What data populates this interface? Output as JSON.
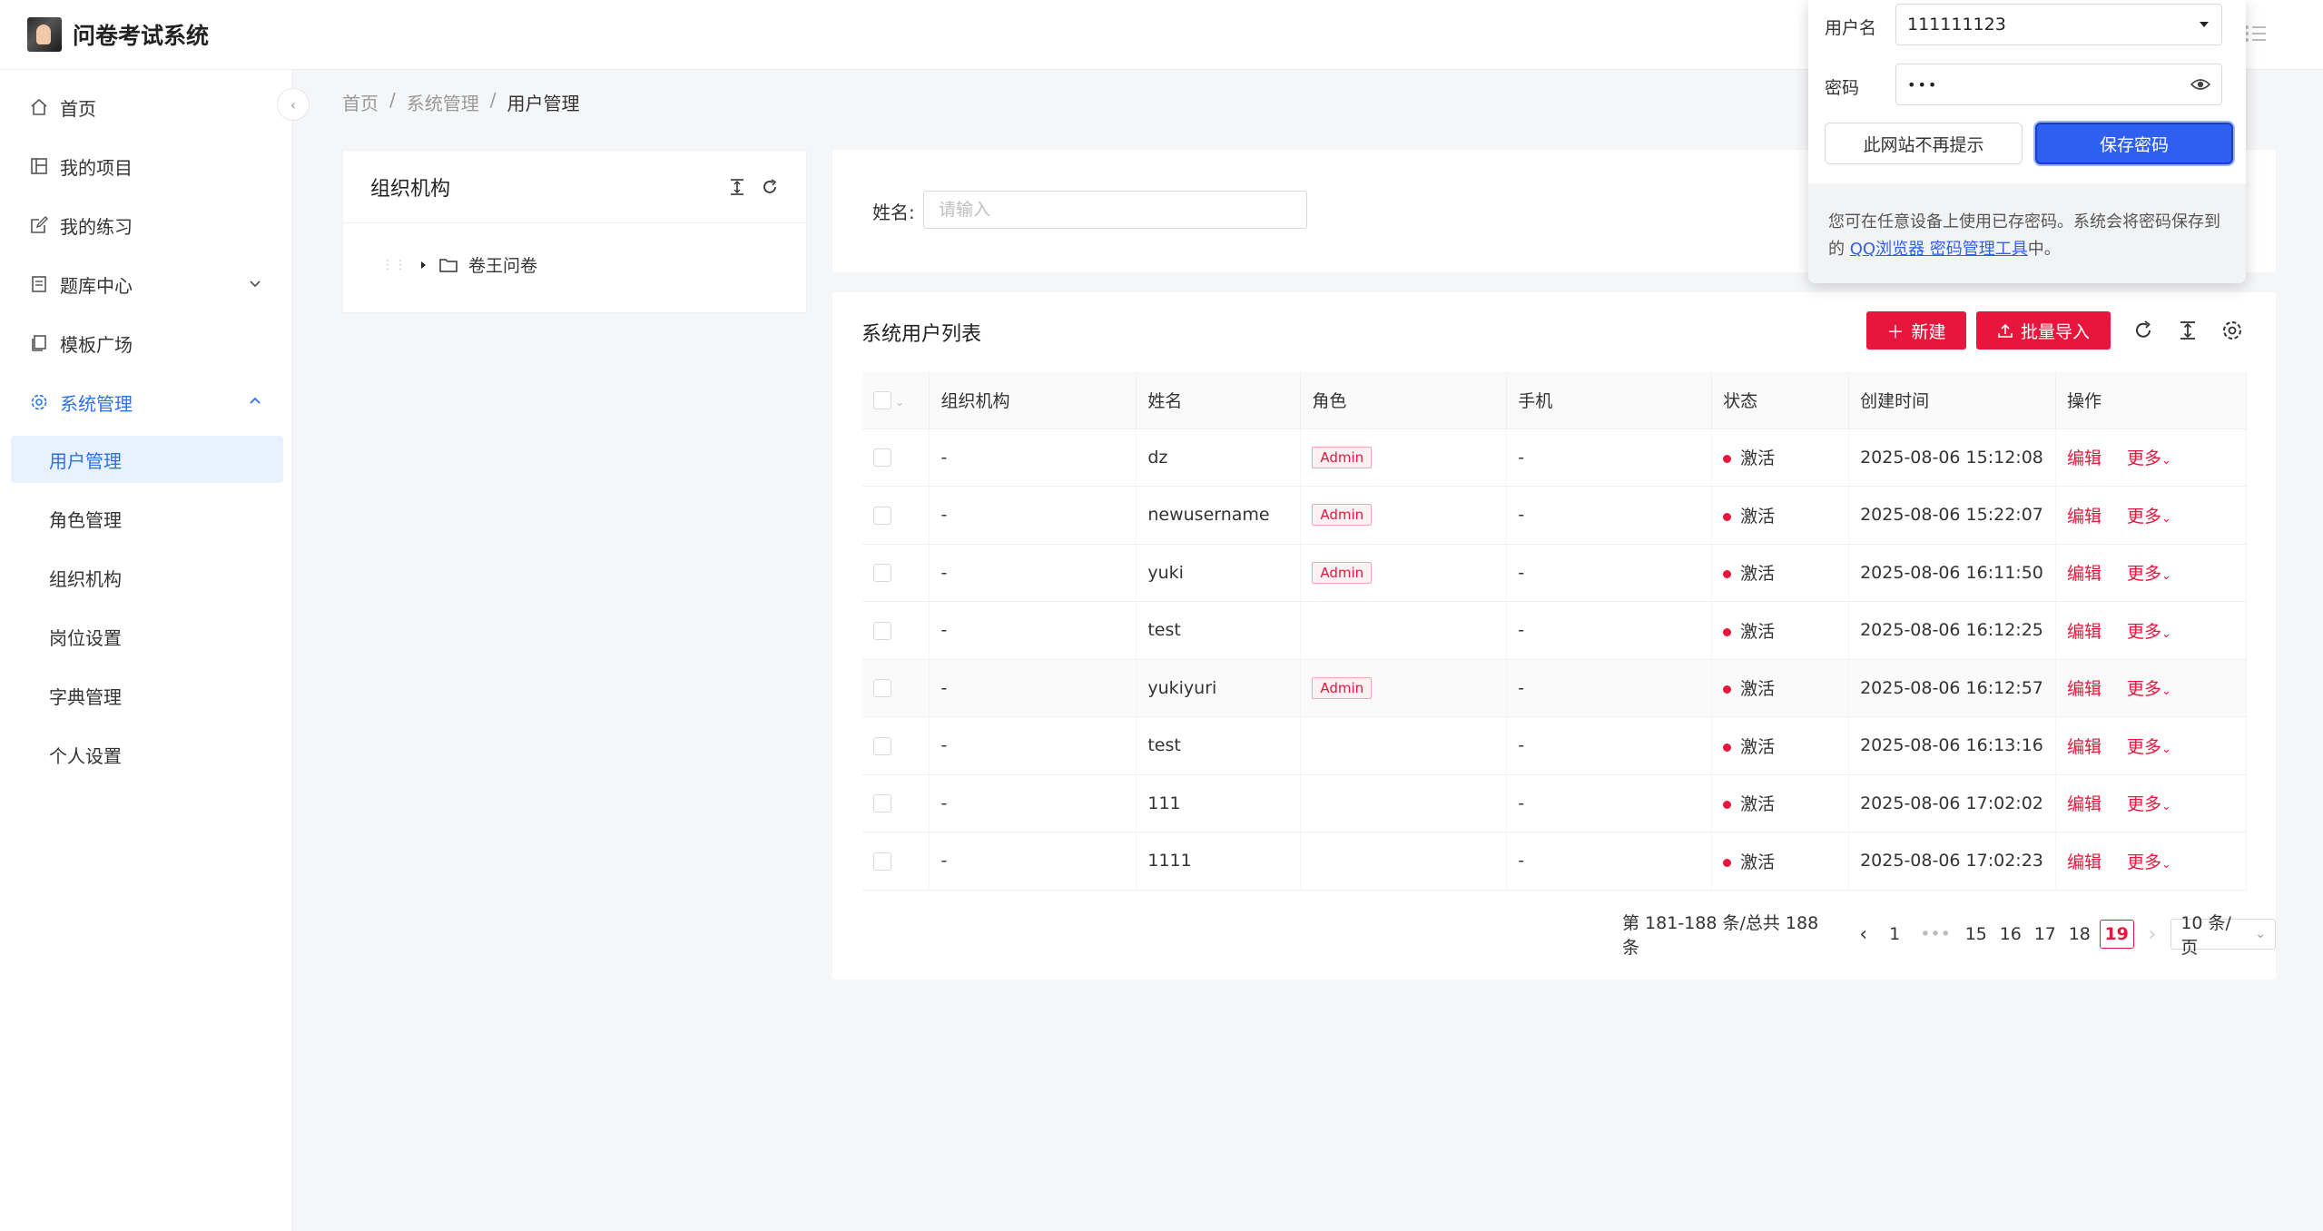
{
  "app": {
    "title": "问卷考试系统"
  },
  "sidebar": {
    "items": [
      {
        "label": "首页",
        "icon": "home-icon"
      },
      {
        "label": "我的项目",
        "icon": "project-icon"
      },
      {
        "label": "我的练习",
        "icon": "edit-icon"
      },
      {
        "label": "题库中心",
        "icon": "book-icon"
      },
      {
        "label": "模板广场",
        "icon": "template-icon"
      },
      {
        "label": "系统管理",
        "icon": "gear-icon"
      }
    ],
    "sub_items": [
      "用户管理",
      "角色管理",
      "组织机构",
      "岗位设置",
      "字典管理",
      "个人设置"
    ]
  },
  "breadcrumb": {
    "home": "首页",
    "parent": "系统管理",
    "current": "用户管理"
  },
  "org_panel": {
    "title": "组织机构",
    "node": "卷王问卷"
  },
  "search": {
    "label": "姓名:",
    "placeholder": "请输入"
  },
  "table_panel": {
    "title": "系统用户列表",
    "new_button": "新建",
    "import_button": "批量导入",
    "columns": [
      "组织机构",
      "姓名",
      "角色",
      "手机",
      "状态",
      "创建时间",
      "操作"
    ],
    "rows": [
      {
        "org": "-",
        "name": "dz",
        "role": "Admin",
        "phone": "-",
        "status": "激活",
        "created": "2025-08-06 15:12:08"
      },
      {
        "org": "-",
        "name": "newusername",
        "role": "Admin",
        "phone": "-",
        "status": "激活",
        "created": "2025-08-06 15:22:07"
      },
      {
        "org": "-",
        "name": "yuki",
        "role": "Admin",
        "phone": "-",
        "status": "激活",
        "created": "2025-08-06 16:11:50"
      },
      {
        "org": "-",
        "name": "test",
        "role": "",
        "phone": "-",
        "status": "激活",
        "created": "2025-08-06 16:12:25"
      },
      {
        "org": "-",
        "name": "yukiyuri",
        "role": "Admin",
        "phone": "-",
        "status": "激活",
        "created": "2025-08-06 16:12:57"
      },
      {
        "org": "-",
        "name": "test",
        "role": "",
        "phone": "-",
        "status": "激活",
        "created": "2025-08-06 16:13:16"
      },
      {
        "org": "-",
        "name": "111",
        "role": "",
        "phone": "-",
        "status": "激活",
        "created": "2025-08-06 17:02:02"
      },
      {
        "org": "-",
        "name": "1111",
        "role": "",
        "phone": "-",
        "status": "激活",
        "created": "2025-08-06 17:02:23"
      }
    ],
    "edit_label": "编辑",
    "more_label": "更多"
  },
  "pagination": {
    "summary": "第 181-188 条/总共 188 条",
    "pages": [
      "1",
      "15",
      "16",
      "17",
      "18",
      "19"
    ],
    "current": "19",
    "page_size": "10 条/页"
  },
  "password_popup": {
    "username_label": "用户名",
    "username_value": "111111123",
    "password_label": "密码",
    "password_value": "•••",
    "never_button": "此网站不再提示",
    "save_button": "保存密码",
    "footer_text": "您可在任意设备上使用已存密码。系统会将密码保存到的 ",
    "footer_link": "QQ浏览器 密码管理工具",
    "footer_suffix": "中。"
  },
  "colors": {
    "accent_blue": "#2f6fec",
    "brand_red": "#e8163c",
    "popup_blue": "#2f5ff0"
  }
}
